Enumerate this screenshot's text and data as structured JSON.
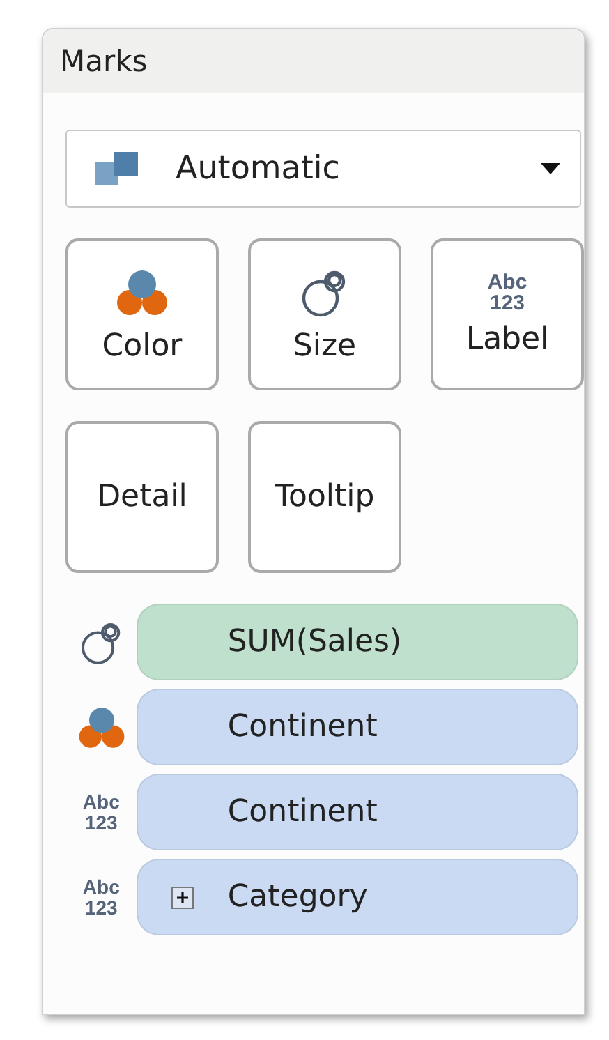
{
  "panel": {
    "title": "Marks"
  },
  "mark_type": {
    "value": "Automatic"
  },
  "cards": [
    {
      "label": "Color",
      "kind": "color"
    },
    {
      "label": "Size",
      "kind": "size"
    },
    {
      "label": "Label",
      "kind": "label",
      "icon_text": [
        "Abc",
        "123"
      ]
    },
    {
      "label": "Detail",
      "kind": "detail"
    },
    {
      "label": "Tooltip",
      "kind": "tooltip"
    }
  ],
  "shelf": [
    {
      "label": "SUM(Sales)",
      "color": "#bfe0cc",
      "kind": "size",
      "collapsible": false
    },
    {
      "label": "Continent",
      "color": "#c9daf2",
      "kind": "color",
      "collapsible": false
    },
    {
      "label": "Continent",
      "color": "#c9daf2",
      "kind": "label",
      "icon_text": [
        "Abc",
        "123"
      ],
      "collapsible": false
    },
    {
      "label": "Category",
      "color": "#c9daf2",
      "kind": "label",
      "icon_text": [
        "Abc",
        "123"
      ],
      "collapsible": true
    }
  ]
}
